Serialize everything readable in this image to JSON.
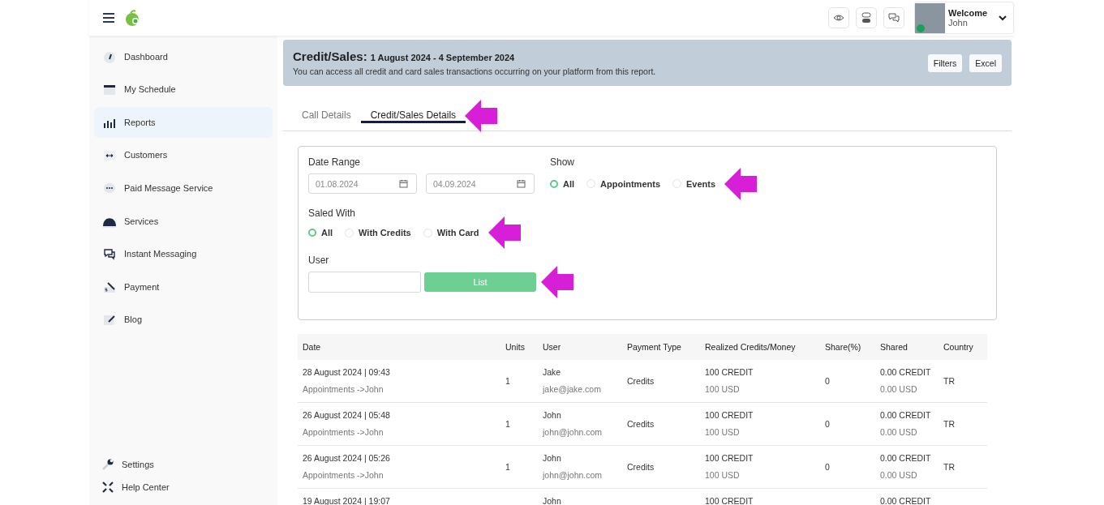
{
  "header": {
    "welcome": "Welcome",
    "user_name": "John",
    "online": true
  },
  "sidebar": {
    "items": [
      {
        "label": "Dashboard",
        "selected": false
      },
      {
        "label": "My Schedule",
        "selected": false
      },
      {
        "label": "Reports",
        "selected": true
      },
      {
        "label": "Customers",
        "selected": false
      },
      {
        "label": "Paid Message Service",
        "selected": false
      },
      {
        "label": "Services",
        "selected": false
      },
      {
        "label": "Instant Messaging",
        "selected": false
      },
      {
        "label": "Payment",
        "selected": false
      },
      {
        "label": "Blog",
        "selected": false
      }
    ],
    "footer_items": [
      {
        "label": "Settings"
      },
      {
        "label": "Help Center"
      }
    ]
  },
  "banner": {
    "title": "Credit/Sales:",
    "date_range": "1 August 2024 - 4 September 2024",
    "description": "You can access all credit and card sales transactions occurring on your platform from this report.",
    "buttons": [
      "Filters",
      "Excel"
    ]
  },
  "tabs": [
    {
      "label": "Call Details",
      "selected": false
    },
    {
      "label": "Credit/Sales Details",
      "selected": true
    }
  ],
  "filters": {
    "date_range": {
      "label": "Date Range",
      "from": "01.08.2024",
      "to": "04.09.2024"
    },
    "show": {
      "label": "Show",
      "options": [
        {
          "label": "All",
          "selected": true
        },
        {
          "label": "Appointments",
          "selected": false
        },
        {
          "label": "Events",
          "selected": false
        }
      ]
    },
    "saled_with": {
      "label": "Saled With",
      "options": [
        {
          "label": "All",
          "selected": true
        },
        {
          "label": "With Credits",
          "selected": false
        },
        {
          "label": "With Card",
          "selected": false
        }
      ]
    },
    "user": {
      "label": "User"
    },
    "list_button": "List"
  },
  "table": {
    "columns": [
      "Date",
      "Units",
      "User",
      "Payment Type",
      "Realized Credits/Money",
      "Share(%)",
      "Shared",
      "Country"
    ],
    "rows": [
      {
        "date": "28 August 2024 | 09:43",
        "detail": "Appointments ->John",
        "units": "1",
        "user": "Jake",
        "email": "jake@jake.com",
        "payment_type": "Credits",
        "realized_credits": "100 CREDIT",
        "realized_money": "100 USD",
        "share": "0",
        "shared_credits": "0.00 CREDIT",
        "shared_money": "0.00 USD",
        "country": "TR"
      },
      {
        "date": "26 August 2024 | 05:48",
        "detail": "Appointments ->John",
        "units": "1",
        "user": "John",
        "email": "john@john.com",
        "payment_type": "Credits",
        "realized_credits": "100 CREDIT",
        "realized_money": "100 USD",
        "share": "0",
        "shared_credits": "0.00 CREDIT",
        "shared_money": "0.00 USD",
        "country": "TR"
      },
      {
        "date": "26 August 2024 | 05:26",
        "detail": "Appointments ->John",
        "units": "1",
        "user": "John",
        "email": "john@john.com",
        "payment_type": "Credits",
        "realized_credits": "100 CREDIT",
        "realized_money": "100 USD",
        "share": "0",
        "shared_credits": "0.00 CREDIT",
        "shared_money": "0.00 USD",
        "country": "TR"
      },
      {
        "date": "19 August 2024 | 19:07",
        "user": "John",
        "realized_credits": "100 CREDIT",
        "shared_credits": "0.00 CREDIT"
      }
    ]
  }
}
